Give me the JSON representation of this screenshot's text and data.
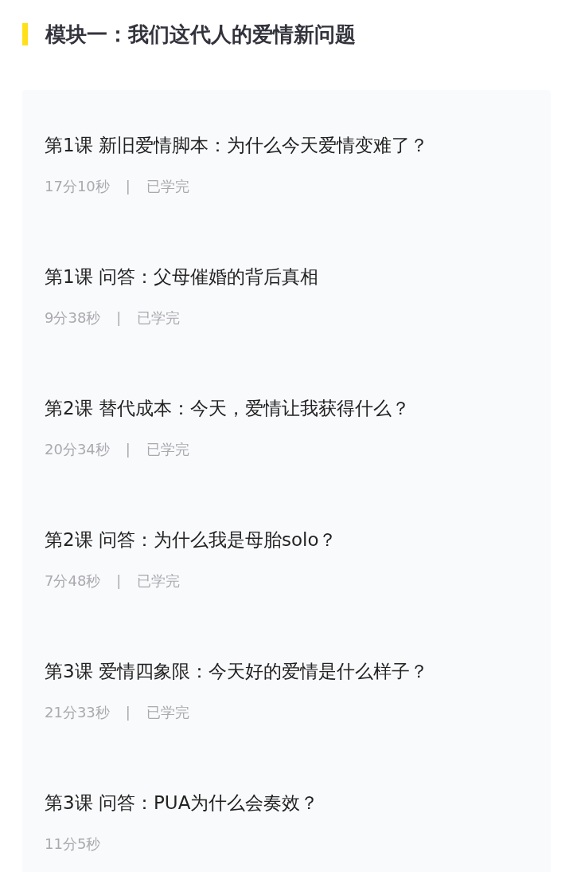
{
  "module": {
    "title": "模块一：我们这代人的爱情新问题"
  },
  "lessons": [
    {
      "title": "第1课 新旧爱情脚本：为什么今天爱情变难了？",
      "duration": "17分10秒",
      "separator": "|",
      "status": "已学完"
    },
    {
      "title": "第1课 问答：父母催婚的背后真相",
      "duration": "9分38秒",
      "separator": "|",
      "status": "已学完"
    },
    {
      "title": "第2课 替代成本：今天，爱情让我获得什么？",
      "duration": "20分34秒",
      "separator": "|",
      "status": "已学完"
    },
    {
      "title": "第2课 问答：为什么我是母胎solo？",
      "duration": "7分48秒",
      "separator": "|",
      "status": "已学完"
    },
    {
      "title": "第3课 爱情四象限：今天好的爱情是什么样子？",
      "duration": "21分33秒",
      "separator": "|",
      "status": "已学完"
    },
    {
      "title": "第3课 问答：PUA为什么会奏效？",
      "duration": "11分5秒"
    }
  ]
}
